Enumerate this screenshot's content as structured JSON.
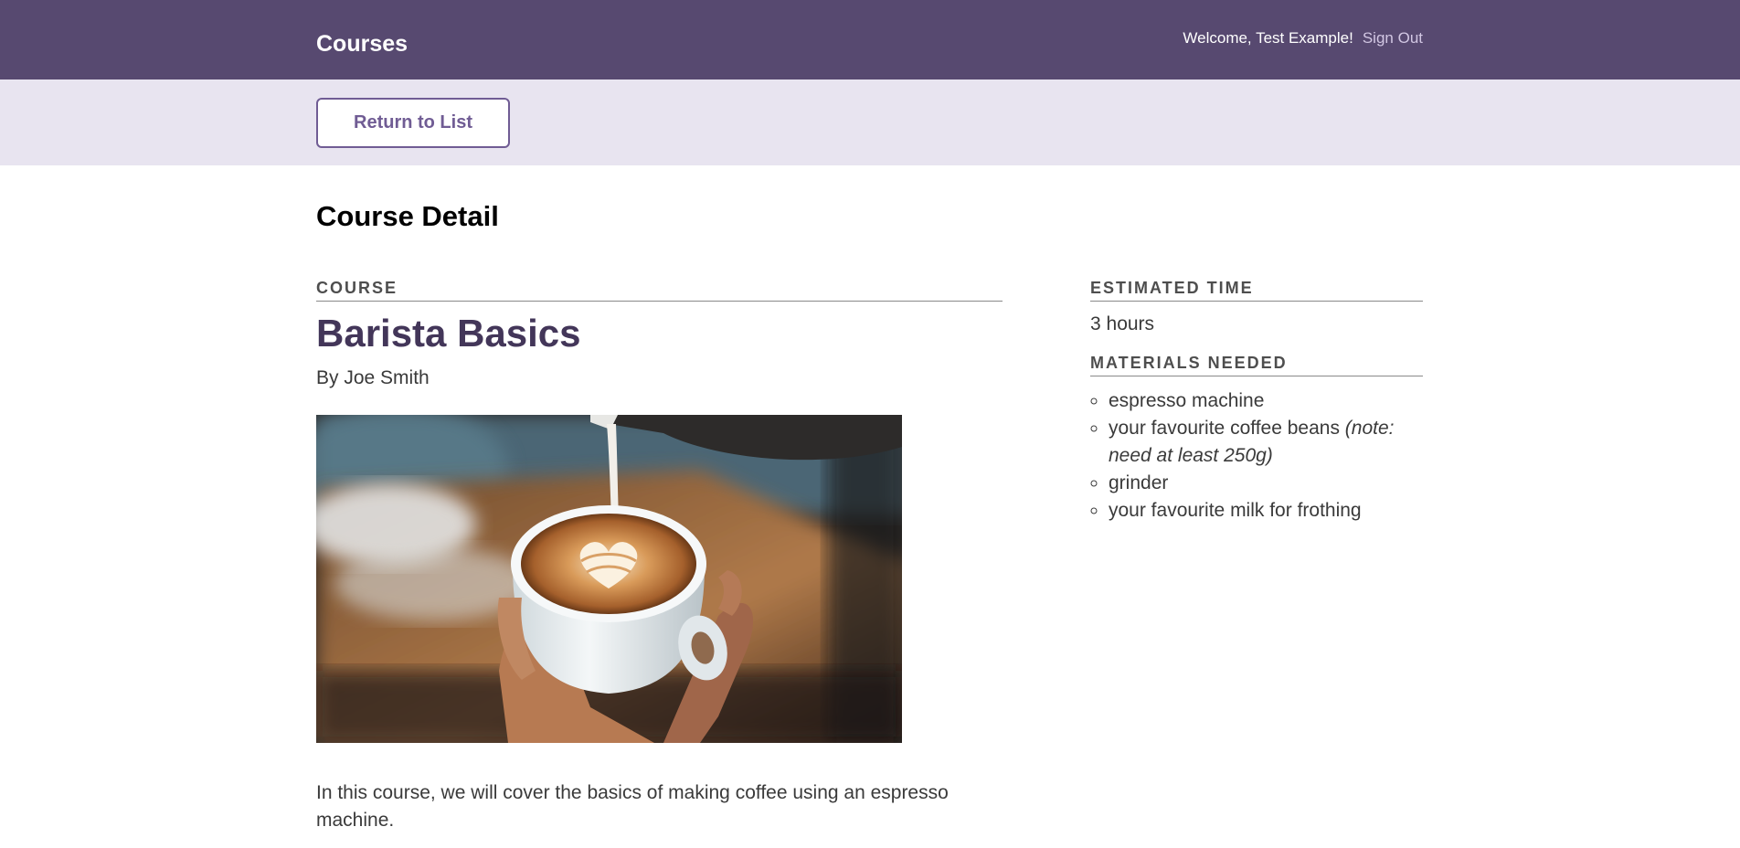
{
  "header": {
    "logo": "Courses",
    "welcome": "Welcome, Test Example!",
    "sign_out": "Sign Out",
    "background_color": "#574970"
  },
  "actions": {
    "return_label": "Return to List",
    "bar_color": "#e8e4f0"
  },
  "page": {
    "title": "Course Detail"
  },
  "course": {
    "section_label": "Course",
    "title": "Barista Basics",
    "author": "By Joe Smith",
    "image_subject": "latte-art-pour-photo",
    "description": "In this course, we will cover the basics of making coffee using an espresso machine."
  },
  "estimated_time": {
    "label": "Estimated Time",
    "value": "3 hours"
  },
  "materials": {
    "label": "Materials Needed",
    "items": [
      {
        "text": "espresso machine",
        "note": ""
      },
      {
        "text": "your favourite coffee beans ",
        "note": "(note: need at least 250g)"
      },
      {
        "text": "grinder",
        "note": ""
      },
      {
        "text": "your favourite milk for frothing",
        "note": ""
      }
    ]
  },
  "colors": {
    "accent": "#705c94",
    "title_color": "#433659"
  }
}
